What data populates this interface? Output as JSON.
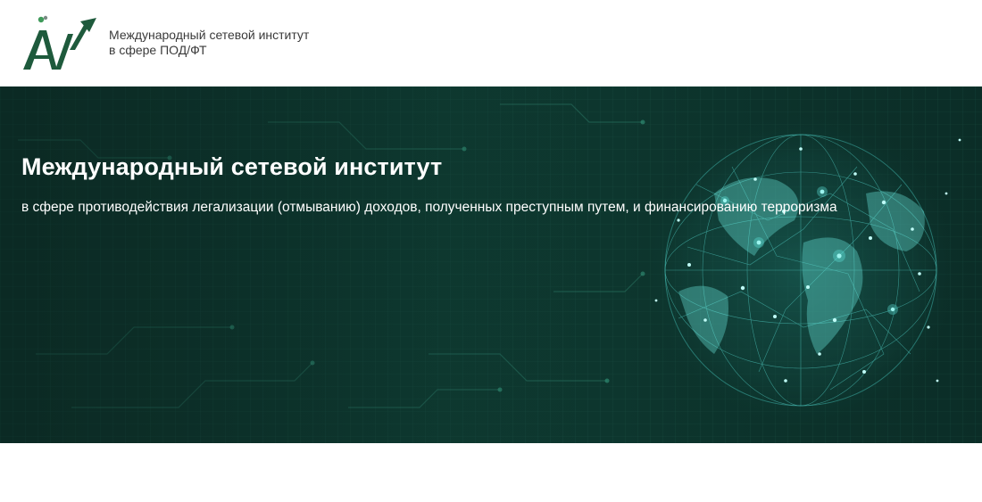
{
  "header": {
    "logo": {
      "icon": "iaw-logo-icon",
      "line1": "Международный сетевой институт",
      "line2": "в сфере ПОД/ФТ"
    }
  },
  "hero": {
    "title": "Международный сетевой институт",
    "subtitle": "в сфере противодействия легализации (отмыванию) доходов, полученных преступным путем, и финансированию терроризма",
    "image": "network-globe-illustration"
  },
  "colors": {
    "brand_green": "#1e5a3c",
    "hero_bg": "#0e3a31",
    "globe_glow": "#5fe8e0"
  }
}
